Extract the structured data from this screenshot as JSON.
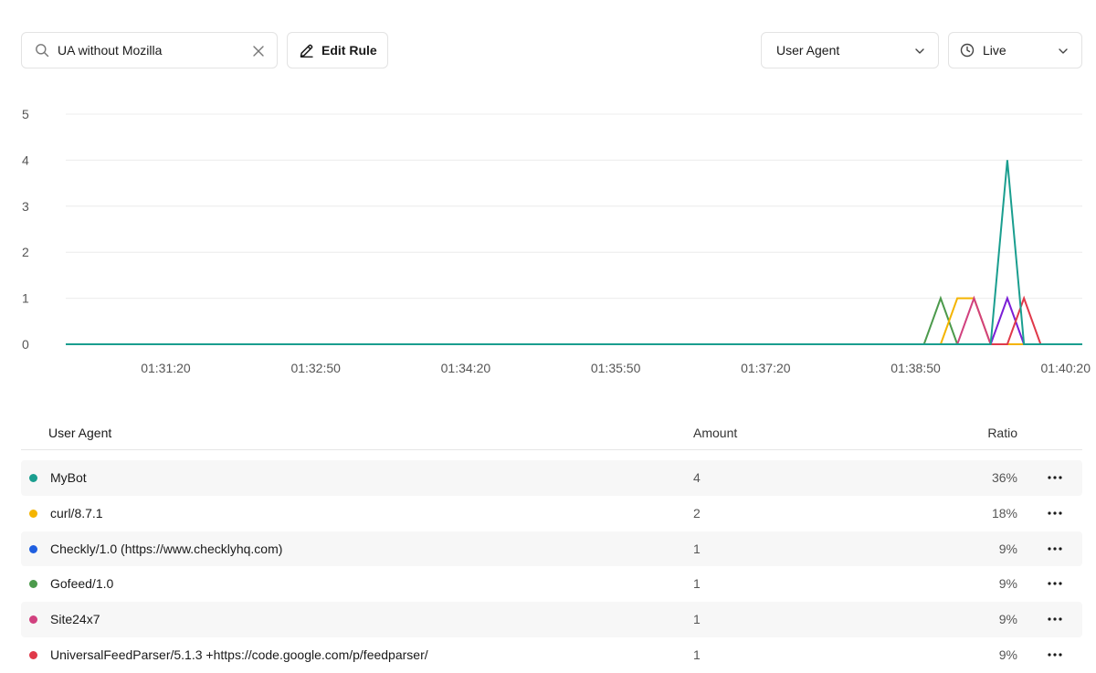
{
  "search": {
    "value": "UA without Mozilla",
    "icon": "search-icon",
    "clear_icon": "close-icon"
  },
  "toolbar": {
    "edit_label": "Edit Rule",
    "edit_icon": "pencil-icon"
  },
  "group_select": {
    "value": "User Agent"
  },
  "time_select": {
    "value": "Live",
    "icon": "clock-icon"
  },
  "colors": {
    "MyBot": "#1a9e8f",
    "curl": "#f4b400",
    "Checkly": "#1f5fe0",
    "Gofeed": "#4c9a4c",
    "Site24x7": "#d1417f",
    "UniversalFeedParser": "#e0394a",
    "purple": "#7b1fd6"
  },
  "chart_data": {
    "type": "line",
    "y_ticks": [
      "0",
      "1",
      "2",
      "3",
      "4",
      "5"
    ],
    "ylim": [
      0,
      5
    ],
    "x_ticks": [
      "01:31:20",
      "01:32:50",
      "01:34:20",
      "01:35:50",
      "01:37:20",
      "01:38:50",
      "01:40:20"
    ],
    "x_range_seconds": [
      "01:30:20",
      "01:40:30"
    ],
    "grid": true,
    "series": [
      {
        "name": "MyBot",
        "color": "#1a9e8f",
        "points": [
          [
            "01:30:20",
            0
          ],
          [
            "01:39:35",
            0
          ],
          [
            "01:39:45",
            4
          ],
          [
            "01:39:55",
            0
          ],
          [
            "01:40:30",
            0
          ]
        ]
      },
      {
        "name": "Gofeed/1.0",
        "color": "#4c9a4c",
        "points": [
          [
            "01:38:55",
            0
          ],
          [
            "01:39:05",
            1
          ],
          [
            "01:39:15",
            0
          ]
        ]
      },
      {
        "name": "curl/8.7.1",
        "color": "#f4b400",
        "points": [
          [
            "01:39:05",
            0
          ],
          [
            "01:39:15",
            1
          ],
          [
            "01:39:25",
            1
          ],
          [
            "01:39:35",
            0
          ],
          [
            "01:39:45",
            0
          ],
          [
            "01:39:55",
            0
          ]
        ]
      },
      {
        "name": "Site24x7",
        "color": "#d1417f",
        "points": [
          [
            "01:39:15",
            0
          ],
          [
            "01:39:25",
            1
          ],
          [
            "01:39:35",
            0
          ]
        ]
      },
      {
        "name": "Checkly/1.0 (https://www.checklyhq.com)",
        "color": "#7b1fd6",
        "points": [
          [
            "01:39:35",
            0
          ],
          [
            "01:39:45",
            1
          ],
          [
            "01:39:55",
            0
          ]
        ]
      },
      {
        "name": "UniversalFeedParser/5.1.3 +https://code.google.com/p/feedparser/",
        "color": "#e0394a",
        "points": [
          [
            "01:39:35",
            0
          ],
          [
            "01:39:45",
            0
          ],
          [
            "01:39:55",
            1
          ],
          [
            "01:40:05",
            0
          ]
        ]
      }
    ]
  },
  "table": {
    "headers": {
      "user_agent": "User Agent",
      "amount": "Amount",
      "ratio": "Ratio"
    },
    "rows": [
      {
        "name": "MyBot",
        "amount": "4",
        "ratio": "36%",
        "color": "#1a9e8f"
      },
      {
        "name": "curl/8.7.1",
        "amount": "2",
        "ratio": "18%",
        "color": "#f4b400"
      },
      {
        "name": "Checkly/1.0 (https://www.checklyhq.com)",
        "amount": "1",
        "ratio": "9%",
        "color": "#1f5fe0"
      },
      {
        "name": "Gofeed/1.0",
        "amount": "1",
        "ratio": "9%",
        "color": "#4c9a4c"
      },
      {
        "name": "Site24x7",
        "amount": "1",
        "ratio": "9%",
        "color": "#d1417f"
      },
      {
        "name": "UniversalFeedParser/5.1.3 +https://code.google.com/p/feedparser/",
        "amount": "1",
        "ratio": "9%",
        "color": "#e0394a"
      }
    ]
  }
}
